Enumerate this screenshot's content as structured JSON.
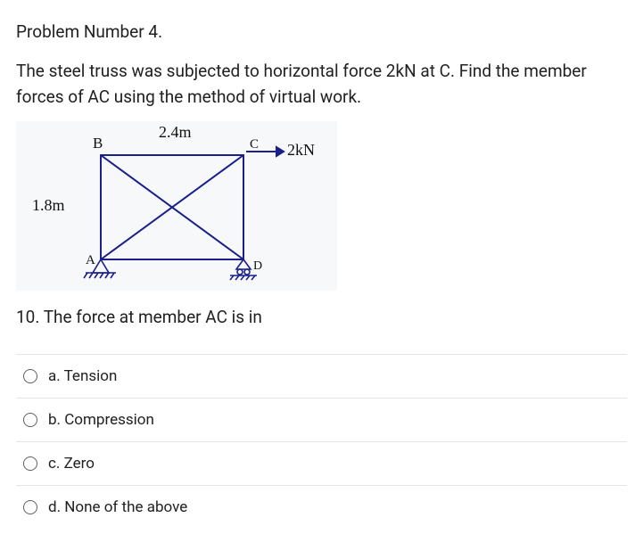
{
  "header": {
    "problem_number": "Problem Number 4."
  },
  "prompt": {
    "text": "The steel truss was subjected to horizontal force 2kN at C. Find the member forces of AC using the method of virtual work."
  },
  "figure": {
    "width_label": "2.4m",
    "height_label": "1.8m",
    "node_b": "B",
    "node_c": "C",
    "node_a": "A",
    "node_d": "D",
    "force_label": "2kN"
  },
  "question": {
    "text": "10. The force at member AC is in"
  },
  "options": [
    {
      "key": "a",
      "label": "a. Tension"
    },
    {
      "key": "b",
      "label": "b. Compression"
    },
    {
      "key": "c",
      "label": "c. Zero"
    },
    {
      "key": "d",
      "label": "d. None of the above"
    }
  ]
}
